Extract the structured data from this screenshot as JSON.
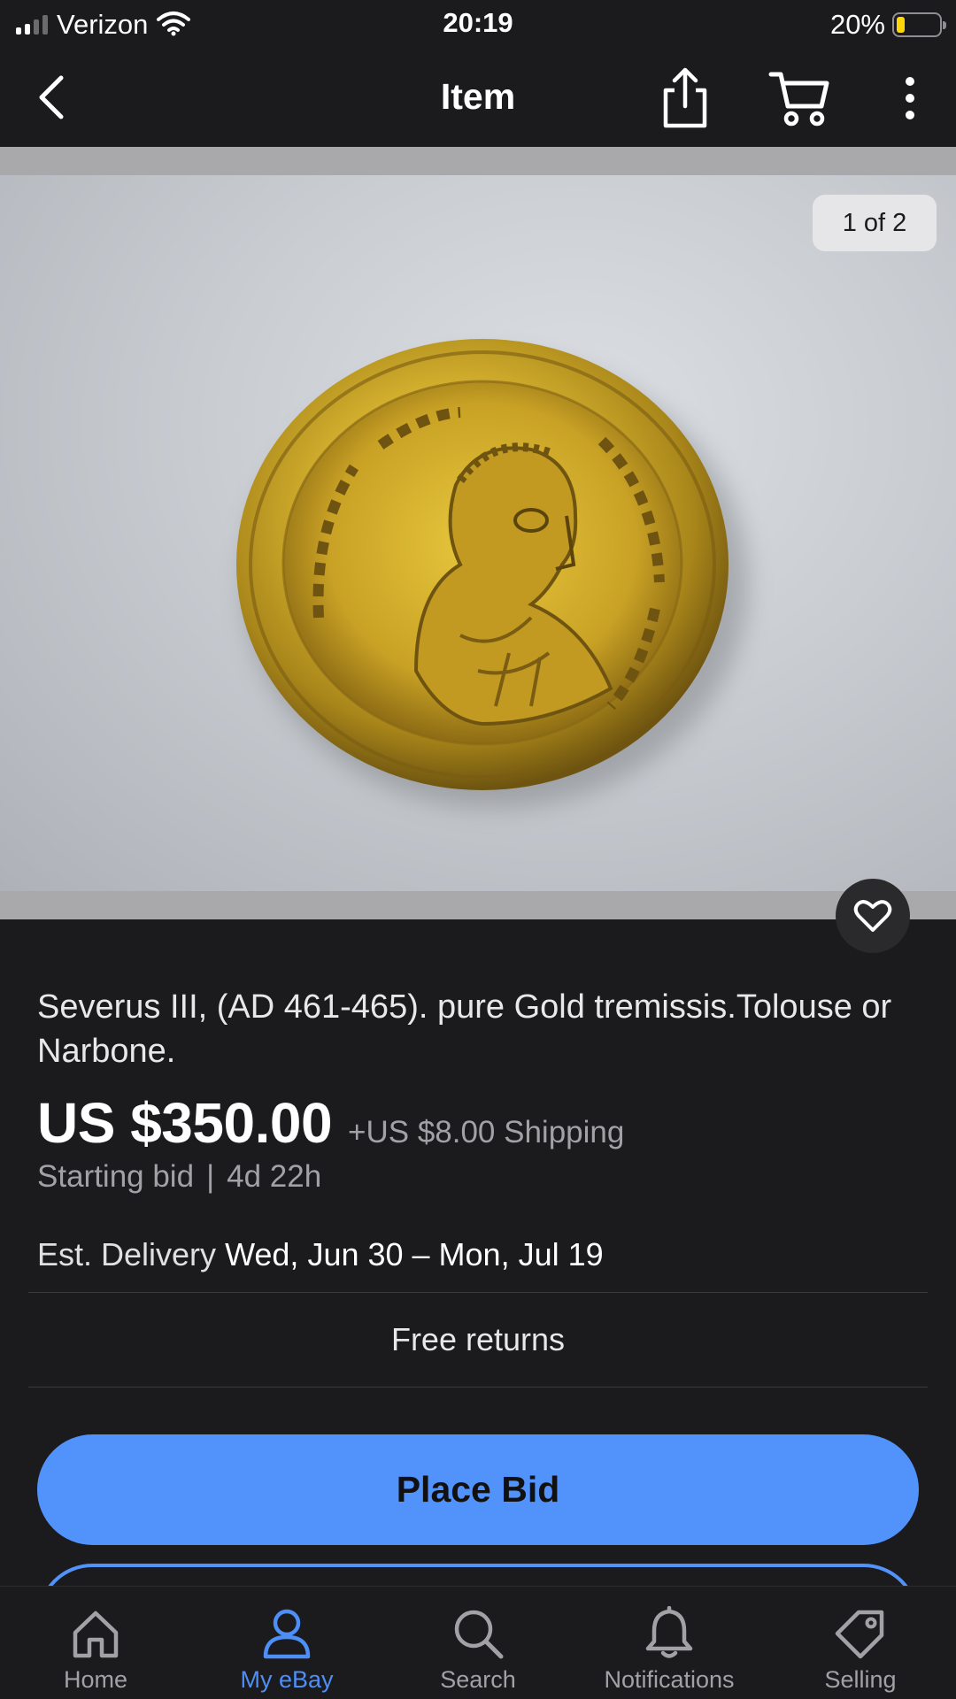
{
  "status_bar": {
    "carrier": "Verizon",
    "time": "20:19",
    "battery_percent": "20%",
    "battery_level": 0.2,
    "signal_bars_filled": 2,
    "signal_bars_total": 4
  },
  "nav": {
    "title": "Item",
    "back_icon": "chevron-left-icon",
    "share_icon": "share-icon",
    "cart_icon": "cart-icon",
    "more_icon": "more-vertical-icon"
  },
  "gallery": {
    "counter": "1 of 2",
    "watch_icon": "heart-icon"
  },
  "item": {
    "title": "Severus III,  (AD 461-465). pure Gold tremissis.Tolouse or Narbone.",
    "price": "US $350.00",
    "shipping": "+US $8.00 Shipping",
    "bid_type": "Starting bid",
    "separator": "|",
    "time_left": "4d 22h",
    "delivery_label": "Est. Delivery",
    "delivery_dates": "Wed, Jun 30 – Mon, Jul 19",
    "returns": "Free returns"
  },
  "actions": {
    "place_bid": "Place Bid"
  },
  "tabs": [
    {
      "label": "Home",
      "icon": "home-icon",
      "active": false
    },
    {
      "label": "My eBay",
      "icon": "user-icon",
      "active": true
    },
    {
      "label": "Search",
      "icon": "search-icon",
      "active": false
    },
    {
      "label": "Notifications",
      "icon": "bell-icon",
      "active": false
    },
    {
      "label": "Selling",
      "icon": "tag-icon",
      "active": false
    }
  ],
  "colors": {
    "background": "#1b1b1d",
    "accent": "#5193fb",
    "active_tab": "#4e8ef7",
    "muted_text": "#a1a1a6",
    "battery": "#ffd60a"
  }
}
